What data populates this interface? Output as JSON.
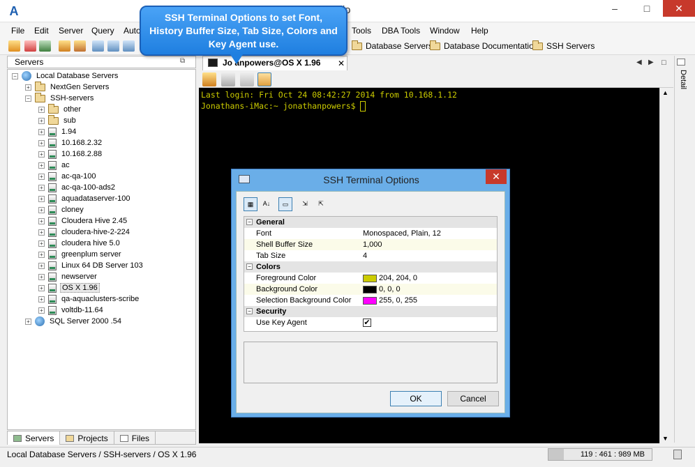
{
  "window": {
    "title": "tudio",
    "logo": "A",
    "minimize": "–",
    "maximize": "□",
    "close": "✕"
  },
  "menu": [
    "File",
    "Edit",
    "Server",
    "Query",
    "Auto",
    "Tools",
    "DBA Tools",
    "Window",
    "Help"
  ],
  "bookmarks": [
    "Database Servers",
    "Database Documentation",
    "SSH Servers"
  ],
  "callout": {
    "text": "SSH Terminal Options to set Font, History Buffer Size, Tab Size, Colors and Key Agent use."
  },
  "servers_panel": {
    "title": "Servers",
    "restore_icon": "⧉"
  },
  "tree": [
    {
      "label": "Local Database Servers",
      "level": 0,
      "icon": "globe",
      "expander": "−"
    },
    {
      "label": "NextGen Servers",
      "level": 1,
      "icon": "folder",
      "expander": "+"
    },
    {
      "label": "SSH-servers",
      "level": 1,
      "icon": "folder",
      "expander": "−"
    },
    {
      "label": "other",
      "level": 2,
      "icon": "folder",
      "expander": "+"
    },
    {
      "label": "sub",
      "level": 2,
      "icon": "folder",
      "expander": "+"
    },
    {
      "label": "1.94",
      "level": 2,
      "icon": "server",
      "expander": "+"
    },
    {
      "label": "10.168.2.32",
      "level": 2,
      "icon": "server",
      "expander": "+"
    },
    {
      "label": "10.168.2.88",
      "level": 2,
      "icon": "server",
      "expander": "+"
    },
    {
      "label": "ac",
      "level": 2,
      "icon": "server",
      "expander": "+"
    },
    {
      "label": "ac-qa-100",
      "level": 2,
      "icon": "server",
      "expander": "+"
    },
    {
      "label": "ac-qa-100-ads2",
      "level": 2,
      "icon": "server",
      "expander": "+"
    },
    {
      "label": "aquadataserver-100",
      "level": 2,
      "icon": "server",
      "expander": "+"
    },
    {
      "label": "cloney",
      "level": 2,
      "icon": "server",
      "expander": "+"
    },
    {
      "label": "Cloudera Hive 2.45",
      "level": 2,
      "icon": "server",
      "expander": "+"
    },
    {
      "label": "cloudera-hive-2-224",
      "level": 2,
      "icon": "server",
      "expander": "+"
    },
    {
      "label": "cloudera hive 5.0",
      "level": 2,
      "icon": "server",
      "expander": "+"
    },
    {
      "label": "greenplum server",
      "level": 2,
      "icon": "server",
      "expander": "+"
    },
    {
      "label": "Linux 64 DB Server 103",
      "level": 2,
      "icon": "server",
      "expander": "+"
    },
    {
      "label": "newserver",
      "level": 2,
      "icon": "server",
      "expander": "+"
    },
    {
      "label": "OS X 1.96",
      "level": 2,
      "icon": "server",
      "expander": "+",
      "selected": true
    },
    {
      "label": "qa-aquaclusters-scribe",
      "level": 2,
      "icon": "server",
      "expander": "+"
    },
    {
      "label": "voltdb-11.64",
      "level": 2,
      "icon": "server",
      "expander": "+"
    },
    {
      "label": "SQL Server 2000 .54",
      "level": 1,
      "icon": "globe",
      "expander": "+"
    }
  ],
  "bottom_tabs": [
    "Servers",
    "Projects",
    "Files"
  ],
  "editor_tab": {
    "label": "Jo    anpowers@OS X 1.96",
    "close": "✕"
  },
  "detail_label": "Detail",
  "terminal": {
    "line1": "Last login: Fri Oct 24 08:42:27 2014 from 10.168.1.12",
    "line2": "Jonathans-iMac:~ jonathanpowers$ "
  },
  "status": {
    "path": "Local Database Servers / SSH-servers / OS X 1.96",
    "memory": "119 : 461 : 989 MB"
  },
  "dialog": {
    "title": "SSH Terminal Options",
    "close": "✕",
    "rows": [
      {
        "type": "cat",
        "name": "General"
      },
      {
        "type": "prop",
        "name": "Font",
        "value": "Monospaced, Plain, 12"
      },
      {
        "type": "prop",
        "name": "Shell Buffer Size",
        "value": "1,000",
        "alt": true
      },
      {
        "type": "prop",
        "name": "Tab Size",
        "value": "4"
      },
      {
        "type": "cat",
        "name": "Colors"
      },
      {
        "type": "prop",
        "name": "Foreground Color",
        "value": "204, 204, 0",
        "color": "#cccc00"
      },
      {
        "type": "prop",
        "name": "Background Color",
        "value": "0, 0, 0",
        "color": "#000000",
        "alt": true
      },
      {
        "type": "prop",
        "name": "Selection Background Color",
        "value": "255, 0, 255",
        "color": "#ff00ff"
      },
      {
        "type": "cat",
        "name": "Security"
      },
      {
        "type": "prop",
        "name": "Use Key Agent",
        "value": "✔",
        "checkbox": true
      }
    ],
    "ok": "OK",
    "cancel": "Cancel"
  }
}
